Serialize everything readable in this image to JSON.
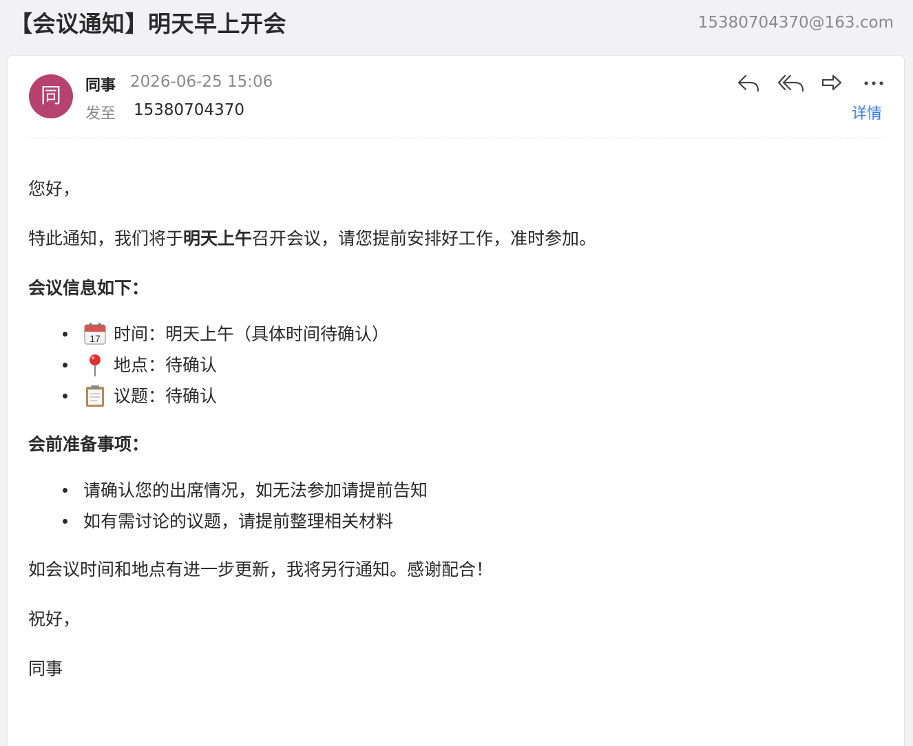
{
  "header": {
    "subject": "【会议通知】明天早上开会",
    "account": "15380704370@163.com"
  },
  "message": {
    "avatar_text": "同",
    "sender_name": "同事",
    "sent_time": "2026-06-25 15:06",
    "to_label": "发至",
    "to_value": "15380704370",
    "details_label": "详情",
    "actions": [
      "reply-icon",
      "reply-all-icon",
      "forward-icon",
      "more-icon"
    ]
  },
  "body": {
    "greeting": "您好，",
    "intro_before": "特此通知，我们将于",
    "intro_bold": "明天上午",
    "intro_after": "召开会议，请您提前安排好工作，准时参加。",
    "info_heading": "会议信息如下：",
    "info_items": [
      {
        "icon": "calendar-icon",
        "text": "时间：明天上午（具体时间待确认）"
      },
      {
        "icon": "pin-icon",
        "text": "地点：待确认"
      },
      {
        "icon": "clipboard-icon",
        "text": "议题：待确认"
      }
    ],
    "prep_heading": "会前准备事项：",
    "prep_items": [
      "请确认您的出席情况，如无法参加请提前告知",
      "如有需讨论的议题，请提前整理相关材料"
    ],
    "closing": "如会议时间和地点有进一步更新，我将另行通知。感谢配合！",
    "signoff": "祝好，",
    "signature": "同事"
  },
  "colors": {
    "avatar_bg": "#b6426f",
    "link": "#3b7de8",
    "muted": "#8a8a8e"
  }
}
